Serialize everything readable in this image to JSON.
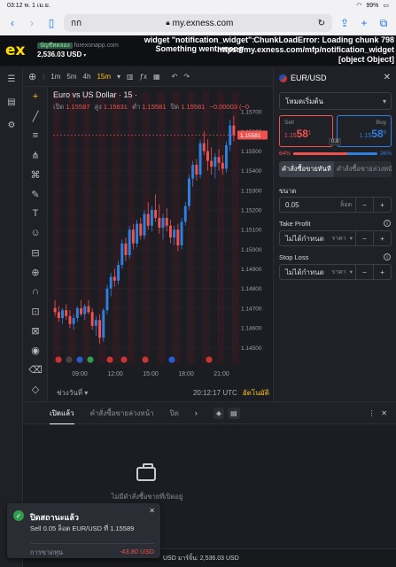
{
  "ios": {
    "time": "03:12",
    "date": "พ. 1 เม.ย.",
    "battery": "99%"
  },
  "safari": {
    "tab_label": "กก",
    "url": "my.exness.com"
  },
  "header": {
    "logo": "ex",
    "account_badge": "บัญชีทดลอง",
    "server": "forexonapp.com",
    "balance": "2,536.03 USD",
    "error_center": "widget \"notification_widget\": Something went wrong",
    "error_right_lines": [
      "ChunkLoadError: Loading chunk 798",
      "https://my.exness.com/mfp/notification_widget",
      "[object Object]"
    ]
  },
  "toolbar": {
    "timeframes": [
      "1m",
      "5m",
      "4h",
      "15m"
    ],
    "active_tf": "15m"
  },
  "chart_legend": {
    "title": "Euro vs US Dollar · 15 ·",
    "open_label": "เปิด",
    "open": "1.15587",
    "high_label": "สูง",
    "high": "1.15631",
    "low_label": "ต่ำ",
    "low": "1.15581",
    "close_label": "ปิด",
    "close": "1.15581",
    "change": "−0.00003 (−0"
  },
  "chart_footer": {
    "period": "ช่วงวันที่",
    "time": "20:12:17 UTC",
    "auto": "อัตโนมัติ"
  },
  "chart_data": {
    "type": "candlestick",
    "symbol": "EURUSD",
    "timeframe": "15m",
    "ylim": [
      1.1442,
      1.158
    ],
    "y_ticks": [
      "1.15700",
      "1.15600",
      "1.15500",
      "1.15400",
      "1.15300",
      "1.15200",
      "1.15100",
      "1.15000",
      "1.14900",
      "1.14800",
      "1.14700",
      "1.14600",
      "1.14500"
    ],
    "x_ticks": [
      "09:00",
      "12:00",
      "15:00",
      "18:00",
      "21:00"
    ],
    "last_price": "1.15581",
    "candles": [
      [
        1.147,
        1.1474,
        1.1466,
        1.1468
      ],
      [
        1.1468,
        1.1471,
        1.1463,
        1.1465
      ],
      [
        1.1465,
        1.147,
        1.1462,
        1.1469
      ],
      [
        1.1469,
        1.1472,
        1.1464,
        1.1466
      ],
      [
        1.1466,
        1.1469,
        1.146,
        1.1462
      ],
      [
        1.1462,
        1.1467,
        1.1459,
        1.1465
      ],
      [
        1.1465,
        1.1471,
        1.1463,
        1.147
      ],
      [
        1.147,
        1.1474,
        1.1466,
        1.1467
      ],
      [
        1.1467,
        1.1472,
        1.1464,
        1.1471
      ],
      [
        1.1471,
        1.1474,
        1.1467,
        1.1468
      ],
      [
        1.1468,
        1.147,
        1.1459,
        1.1461
      ],
      [
        1.1461,
        1.1466,
        1.1456,
        1.1464
      ],
      [
        1.1464,
        1.1467,
        1.1452,
        1.1455
      ],
      [
        1.1455,
        1.147,
        1.1453,
        1.1469
      ],
      [
        1.1469,
        1.1482,
        1.1467,
        1.148
      ],
      [
        1.148,
        1.1488,
        1.1476,
        1.1486
      ],
      [
        1.1486,
        1.149,
        1.1481,
        1.1484
      ],
      [
        1.1484,
        1.1494,
        1.1482,
        1.1492
      ],
      [
        1.1492,
        1.1505,
        1.149,
        1.1503
      ],
      [
        1.1503,
        1.1506,
        1.1494,
        1.1497
      ],
      [
        1.1497,
        1.1512,
        1.1495,
        1.151
      ],
      [
        1.151,
        1.1513,
        1.15,
        1.1503
      ],
      [
        1.1503,
        1.1515,
        1.1501,
        1.1513
      ],
      [
        1.1513,
        1.1516,
        1.1505,
        1.1507
      ],
      [
        1.1507,
        1.152,
        1.1505,
        1.1518
      ],
      [
        1.1518,
        1.1524,
        1.151,
        1.1512
      ],
      [
        1.1512,
        1.1522,
        1.1509,
        1.152
      ],
      [
        1.152,
        1.1528,
        1.1514,
        1.1516
      ],
      [
        1.1516,
        1.1523,
        1.1508,
        1.1511
      ],
      [
        1.1511,
        1.1518,
        1.1505,
        1.1516
      ],
      [
        1.1516,
        1.1521,
        1.1509,
        1.1512
      ],
      [
        1.1512,
        1.1515,
        1.1503,
        1.1506
      ],
      [
        1.1506,
        1.1512,
        1.1502,
        1.151
      ],
      [
        1.151,
        1.1513,
        1.1499,
        1.1502
      ],
      [
        1.1502,
        1.1516,
        1.15,
        1.1514
      ],
      [
        1.1514,
        1.1524,
        1.1512,
        1.1522
      ],
      [
        1.1522,
        1.1538,
        1.152,
        1.1536
      ],
      [
        1.1536,
        1.1545,
        1.1532,
        1.1543
      ],
      [
        1.1543,
        1.1546,
        1.1535,
        1.1538
      ],
      [
        1.1538,
        1.1556,
        1.1536,
        1.1554
      ],
      [
        1.1554,
        1.156,
        1.1548,
        1.155
      ],
      [
        1.155,
        1.1556,
        1.154,
        1.1545
      ],
      [
        1.1545,
        1.1552,
        1.1538,
        1.1542
      ],
      [
        1.1542,
        1.1549,
        1.1536,
        1.1547
      ],
      [
        1.1547,
        1.1551,
        1.154,
        1.1544
      ],
      [
        1.1544,
        1.1548,
        1.1538,
        1.1541
      ],
      [
        1.1541,
        1.1555,
        1.1539,
        1.1553
      ],
      [
        1.1553,
        1.1566,
        1.155,
        1.1563
      ],
      [
        1.1563,
        1.1568,
        1.1555,
        1.1558
      ]
    ]
  },
  "order_panel": {
    "symbol": "EUR/USD",
    "mode": "โหมดเริ่มต้น",
    "sell_label": "Sell",
    "sell_prefix": "1.15",
    "sell_big": "58",
    "sell_sup": "1",
    "buy_label": "Buy",
    "buy_prefix": "1.15",
    "buy_big": "58",
    "buy_sup": "9",
    "spread": "0.8",
    "sentiment_sell": "64%",
    "sentiment_buy": "36%",
    "sentiment_sell_frac": 0.64,
    "tab_market": "คำสั่งซื้อขายทันที",
    "tab_pending": "คำสั่งซื้อขายล่วงหน้า",
    "volume_label": "ขนาด",
    "volume_value": "0.05",
    "volume_unit": "ล็อต",
    "tp_label": "Take Profit",
    "tp_value": "ไม่ได้กำหนด",
    "tp_unit": "ราคา",
    "sl_label": "Stop Loss",
    "sl_value": "ไม่ได้กำหนด",
    "sl_unit": "ราคา"
  },
  "bottom": {
    "tab_open": "เปิดแล้ว",
    "tab_pending": "คำสั่งซื้อขายล่วงหน้า",
    "tab_closed": "ปิด",
    "empty_text": "ไม่มีคำสั่งซื้อขายที่เปิดอยู่",
    "strip": "USD   มาร์จิ้น: 2,536.03 USD"
  },
  "toast": {
    "title": "ปิดสถานะแล้ว",
    "body": "Sell 0.05 ล็อต EUR/USD ที่ 1.15589",
    "pl_label": "การขาดทุน",
    "pl_value": "-43.80 USD"
  },
  "colors": {
    "bull": "#2f7fe0",
    "bear": "#ef5350",
    "accent": "#f5c518",
    "session": "#3a1c22"
  }
}
